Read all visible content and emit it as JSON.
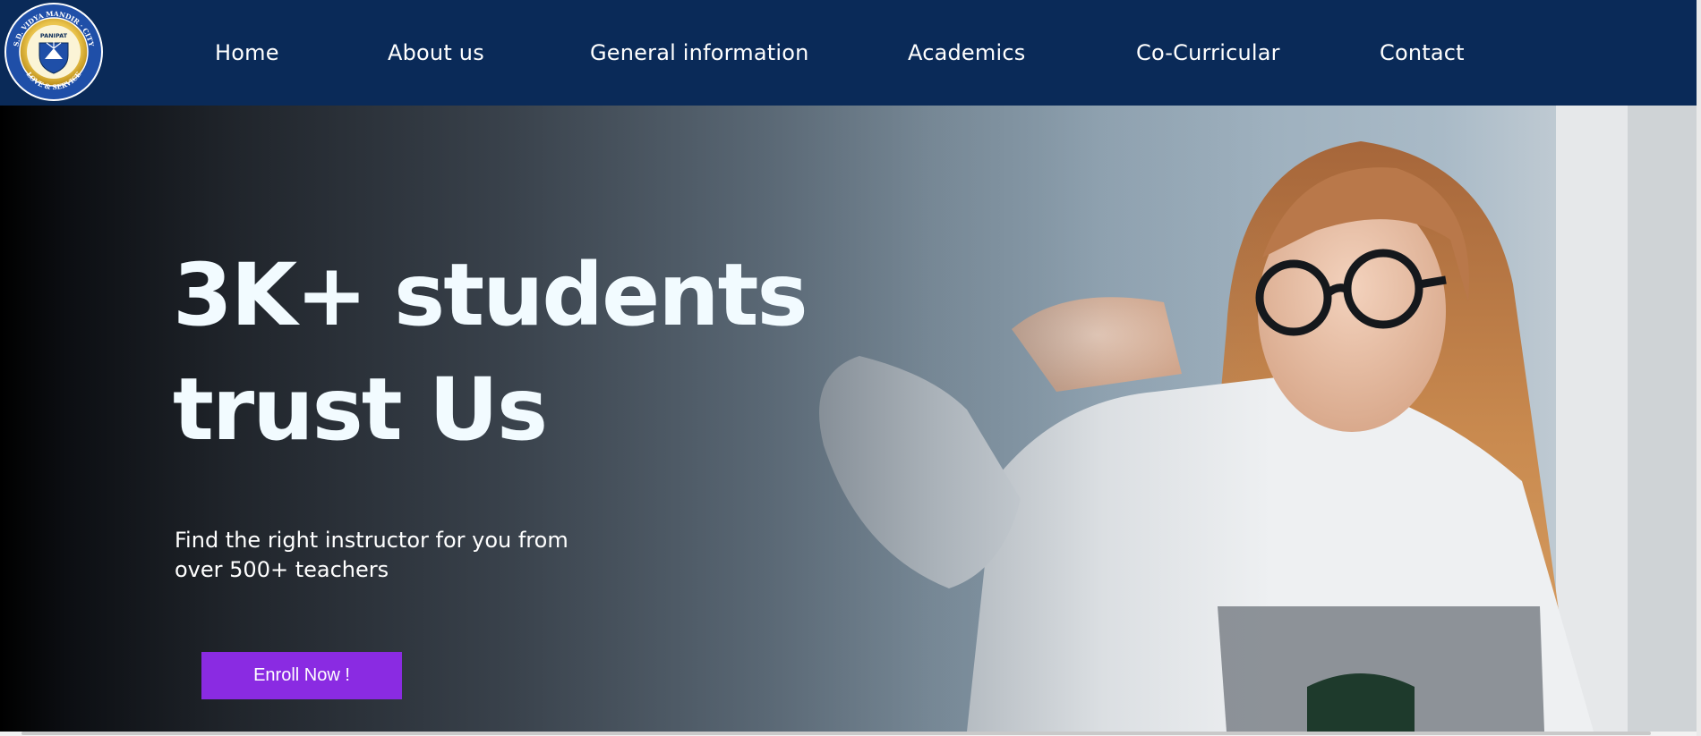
{
  "brand": {
    "logo_top_text": "S.D. VIDYA MANDIR · CITY",
    "logo_center_text": "PANIPAT",
    "logo_bottom_text": "LOVE & SERVICE"
  },
  "nav": {
    "items": [
      {
        "label": "Home"
      },
      {
        "label": "About us"
      },
      {
        "label": "General information"
      },
      {
        "label": "Academics"
      },
      {
        "label": "Co-Curricular"
      },
      {
        "label": "Contact"
      }
    ]
  },
  "hero": {
    "title_line1": "3K+ students",
    "title_line2": "trust Us",
    "subtitle_line1": "Find the right instructor for you from",
    "subtitle_line2": "over 500+ teachers",
    "cta_label": "Enroll Now !"
  },
  "colors": {
    "nav_bg": "#0a2a58",
    "cta_bg": "#8a2be2",
    "title_text": "#f2fbff"
  }
}
